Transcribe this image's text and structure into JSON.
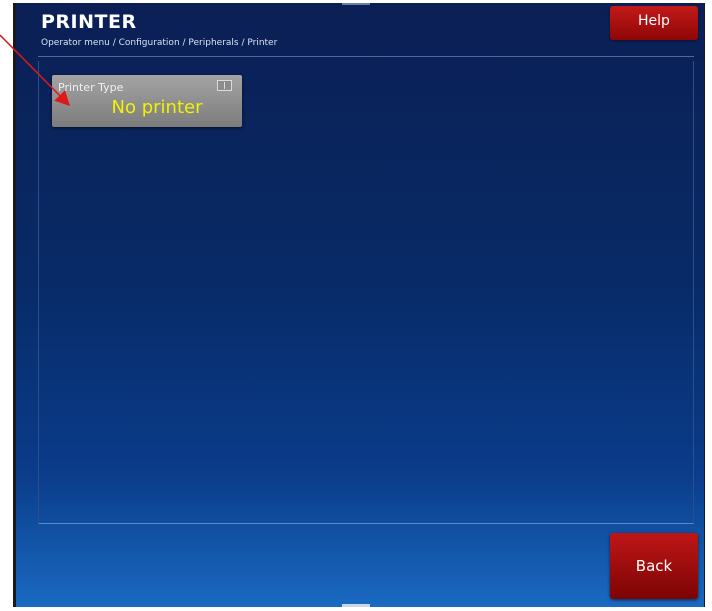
{
  "header": {
    "title": "PRINTER",
    "breadcrumb": "Operator menu / Configuration / Peripherals / Printer"
  },
  "buttons": {
    "help_label": "Help",
    "back_label": "Back"
  },
  "printer_type_tile": {
    "label": "Printer Type",
    "value": "No printer",
    "icon": "selector-icon"
  },
  "colors": {
    "background_top": "#0b1f55",
    "background_bottom": "#1a6ac2",
    "button_red": "#c21a1a",
    "tile_gray": "#8c8c8c",
    "value_yellow": "#f2f200",
    "annotation_red": "#e01818"
  }
}
